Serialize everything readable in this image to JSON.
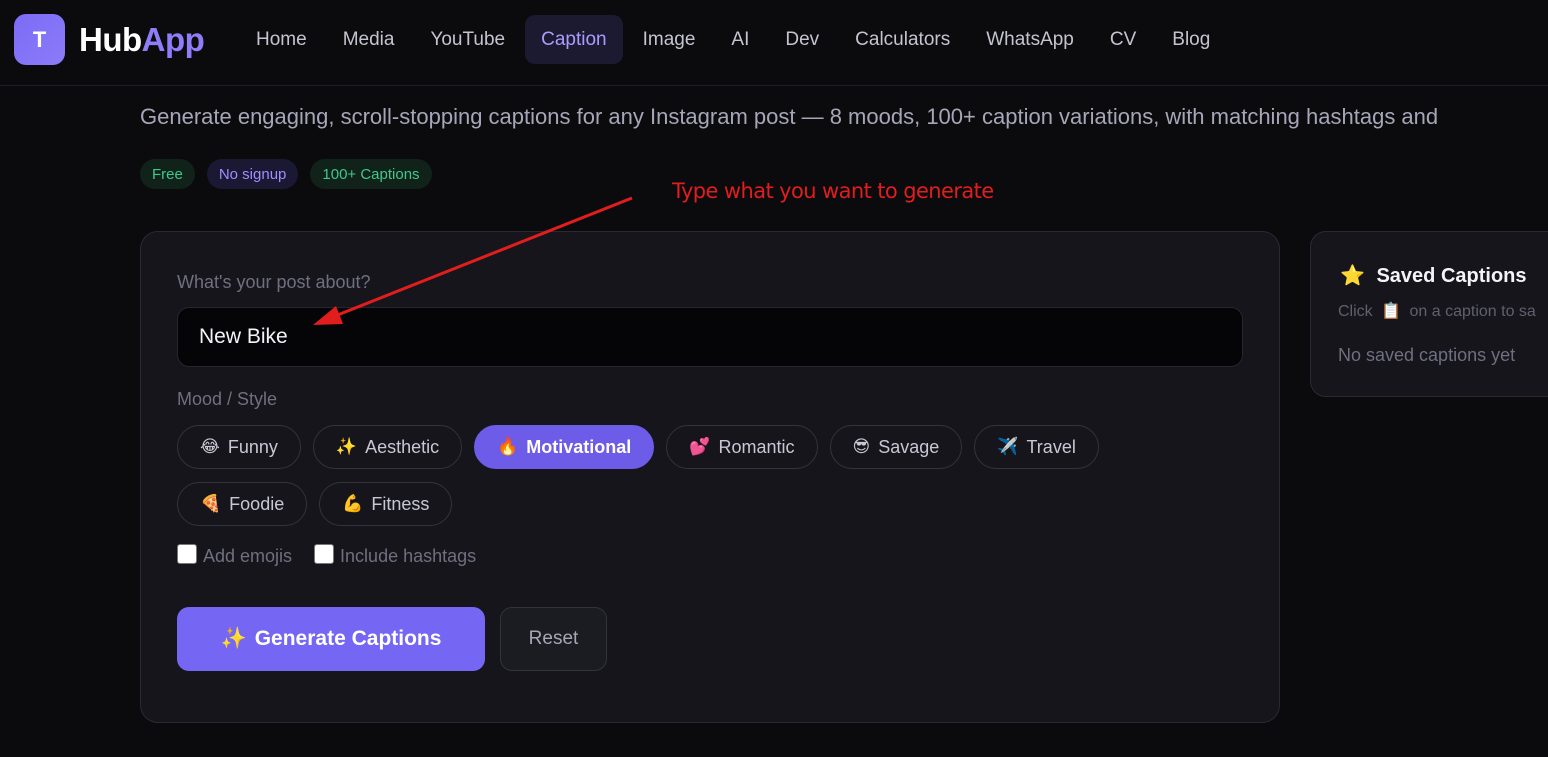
{
  "header": {
    "logo_letter": "T",
    "brand_part1": "Hub",
    "brand_part2": "App",
    "nav": [
      "Home",
      "Media",
      "YouTube",
      "Caption",
      "Image",
      "AI",
      "Dev",
      "Calculators",
      "WhatsApp",
      "CV",
      "Blog"
    ],
    "active_nav": "Caption"
  },
  "intro": {
    "description": "Generate engaging, scroll-stopping captions for any Instagram post — 8 moods, 100+ caption variations, with matching hashtags and",
    "badges": [
      "Free",
      "No signup",
      "100+ Captions"
    ]
  },
  "annotation": {
    "text": "Type what you want to generate",
    "color": "#e11d1d"
  },
  "form": {
    "post_label": "What's your post about?",
    "post_value": "New Bike",
    "mood_label": "Mood / Style",
    "moods": [
      {
        "emoji": "😂",
        "label": "Funny"
      },
      {
        "emoji": "✨",
        "label": "Aesthetic"
      },
      {
        "emoji": "🔥",
        "label": "Motivational"
      },
      {
        "emoji": "💕",
        "label": "Romantic"
      },
      {
        "emoji": "😎",
        "label": "Savage"
      },
      {
        "emoji": "✈️",
        "label": "Travel"
      },
      {
        "emoji": "🍕",
        "label": "Foodie"
      },
      {
        "emoji": "💪",
        "label": "Fitness"
      }
    ],
    "active_mood": "Motivational",
    "add_emojis_label": "Add emojis",
    "add_emojis_checked": false,
    "include_hashtags_label": "Include hashtags",
    "include_hashtags_checked": false,
    "generate_emoji": "✨",
    "generate_label": "Generate Captions",
    "reset_label": "Reset"
  },
  "saved": {
    "title_emoji": "⭐",
    "title": "Saved Captions",
    "hint_prefix": "Click",
    "hint_emoji": "📋",
    "hint_suffix": "on a caption to sa",
    "empty": "No saved captions yet"
  },
  "colors": {
    "accent": "#7566f3",
    "active_nav_bg": "#1c1a30",
    "badge_green": "#3ec98a",
    "badge_purple": "#9d8fff",
    "annotation": "#e11d1d"
  }
}
